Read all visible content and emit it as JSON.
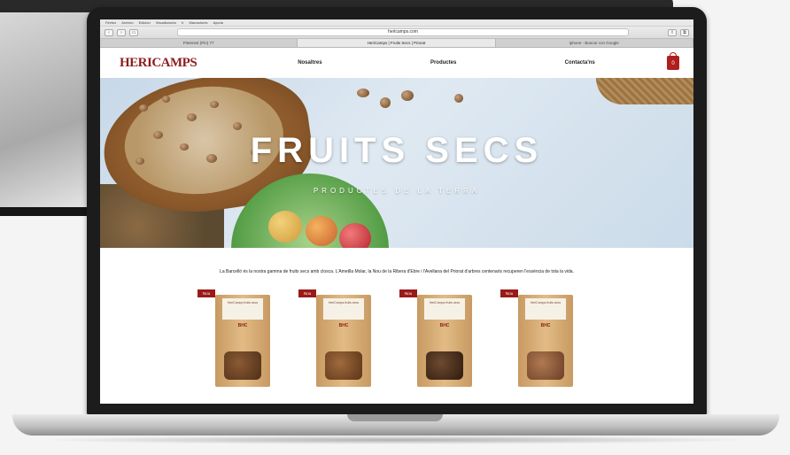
{
  "menubar": {
    "items": [
      "Firefox",
      "Archivo",
      "Edición",
      "Visualización",
      "Ir",
      "Marcadores",
      "Ayuda"
    ]
  },
  "browser": {
    "address": "hericamps.com",
    "tabs": [
      "Pinterest (Pin) 77",
      "HeriCamps | Fruits Secs | Priorat",
      "iphone - Buscar con Google"
    ]
  },
  "site": {
    "logo": "HERICAMPS",
    "nav": [
      "Nosaltres",
      "Productes",
      "Contacta'ns"
    ],
    "cart_count": "0",
    "hero_title": "FRUITS SECS",
    "hero_subtitle": "PRODUCTES DE LA TERRA",
    "intro": "La Barcelló és la nostra gamma de fruits secs amb closca. L'Ametlla Molar, la Nou de la Ribera d'Ebre i l'Avellana del Priorat d'arbres centenaris recuperen l'essència de tota la vida.",
    "products": [
      {
        "badge": "Nou",
        "label": "HeriCamps fruits secs",
        "brand": "BHC"
      },
      {
        "badge": "Nou",
        "label": "HeriCamps fruits secs",
        "brand": "BHC"
      },
      {
        "badge": "Nou",
        "label": "HeriCamps fruits secs",
        "brand": "BHC"
      },
      {
        "badge": "Nou",
        "label": "HeriCamps fruits secs",
        "brand": "BHC"
      }
    ]
  },
  "colors": {
    "brand_red": "#9a1a1a",
    "sky": "#dfe9f2"
  }
}
